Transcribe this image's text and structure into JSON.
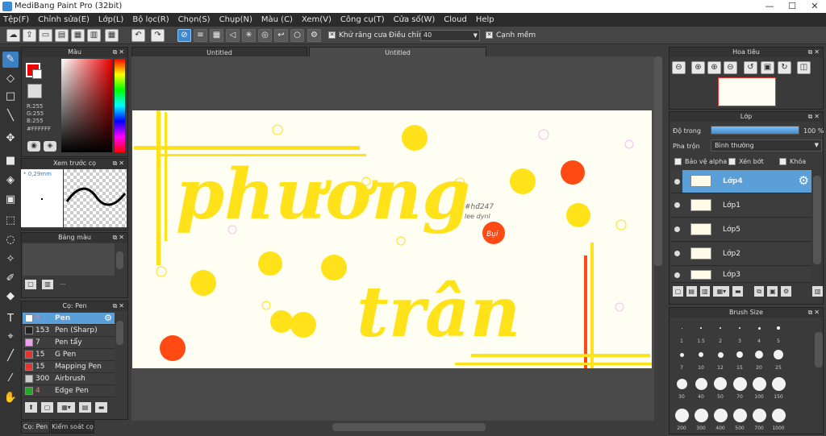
{
  "window": {
    "title": "MediBang Paint Pro (32bit)",
    "min": "—",
    "max": "☐",
    "close": "✕"
  },
  "menu": [
    "Tệp(F)",
    "Chỉnh sửa(E)",
    "Lớp(L)",
    "Bộ lọc(R)",
    "Chọn(S)",
    "Chụp(N)",
    "Màu (C)",
    "Xem(V)",
    "Công cụ(T)",
    "Cửa số(W)",
    "Cloud",
    "Help"
  ],
  "toolbar": {
    "antialias_label": "Khử răng cưa",
    "correction_label": "Điều chỉnh",
    "correction_value": "40",
    "edge_label": "Cạnh mềm",
    "check": "✕"
  },
  "tabs": [
    "Untitled",
    "Untitled"
  ],
  "panels": {
    "color": {
      "title": "Màu",
      "r": "R:255",
      "g": "G:255",
      "b": "B:255",
      "hex": "#FFFFFF"
    },
    "brush_preview": {
      "title": "Xem trước cọ",
      "size": "* 0,29mm"
    },
    "palette": {
      "title": "Bảng màu",
      "dash": "---"
    },
    "brush": {
      "title": "Cọ: Pen",
      "items": [
        {
          "size": "4",
          "name": "Pen",
          "color": "#ffffff"
        },
        {
          "size": "153",
          "name": "Pen (Sharp)",
          "color": "#222222"
        },
        {
          "size": "7",
          "name": "Pen tẩy",
          "color": "#f0a0f0"
        },
        {
          "size": "15",
          "name": "G Pen",
          "color": "#e33333"
        },
        {
          "size": "15",
          "name": "Mapping Pen",
          "color": "#e33333"
        },
        {
          "size": "300",
          "name": "Airbrush",
          "color": "#cccccc"
        },
        {
          "size": "4",
          "name": "Edge Pen",
          "color": "#22aa22"
        }
      ]
    },
    "bottom_tabs": [
      "Cọ: Pen",
      "Kiểm soát cọ"
    ]
  },
  "navigator": {
    "title": "Hoa tiêu"
  },
  "layers": {
    "title": "Lớp",
    "opacity_label": "Độ trong",
    "opacity_value": "100 %",
    "opacity_fraction": 1.0,
    "blend_label": "Pha trộn",
    "blend_value": "Bình thường",
    "protect_alpha": "Bảo vệ alpha",
    "clipping": "Xén bớt",
    "lock": "Khóa",
    "items": [
      "Lớp4",
      "Lớp1",
      "Lớp5",
      "Lớp2",
      "Lớp3"
    ]
  },
  "brush_size": {
    "title": "Brush Size",
    "sizes": [
      "1",
      "1.5",
      "2",
      "3",
      "4",
      "5",
      "7",
      "10",
      "12",
      "15",
      "20",
      "25",
      "30",
      "40",
      "50",
      "70",
      "100",
      "150",
      "200",
      "300",
      "400",
      "500",
      "700",
      "1000"
    ]
  },
  "canvas": {
    "title_word1": "phương",
    "title_word2": "trân",
    "note1": "#hđ247",
    "note2": "lee dynl",
    "badge": "Bụi",
    "colors": {
      "yellow": "#ffe21a",
      "orange": "#ff4a14",
      "bg": "#fffef2"
    }
  }
}
